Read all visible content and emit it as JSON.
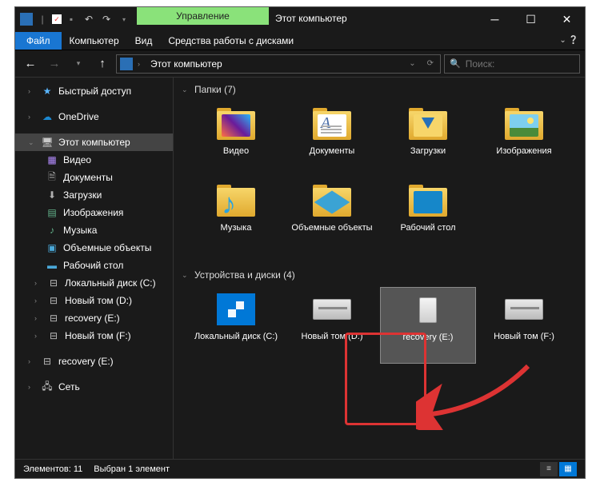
{
  "titlebar": {
    "manage_tab": "Управление",
    "window_title": "Этот компьютер"
  },
  "ribbon": {
    "file": "Файл",
    "computer": "Компьютер",
    "view": "Вид",
    "drive_tools": "Средства работы с дисками"
  },
  "address": {
    "path": "Этот компьютер"
  },
  "search": {
    "placeholder": "Поиск:"
  },
  "sidebar": {
    "quick_access": "Быстрый доступ",
    "onedrive": "OneDrive",
    "this_pc": "Этот компьютер",
    "video": "Видео",
    "documents": "Документы",
    "downloads": "Загрузки",
    "pictures": "Изображения",
    "music": "Музыка",
    "objects3d": "Объемные объекты",
    "desktop": "Рабочий стол",
    "local_c": "Локальный диск (C:)",
    "new_d": "Новый том (D:)",
    "recovery_e": "recovery (E:)",
    "new_f": "Новый том (F:)",
    "recovery_e2": "recovery (E:)",
    "network": "Сеть"
  },
  "sections": {
    "folders": "Папки (7)",
    "devices": "Устройства и диски (4)"
  },
  "folders": {
    "video": "Видео",
    "documents": "Документы",
    "downloads": "Загрузки",
    "pictures": "Изображения",
    "music": "Музыка",
    "objects3d": "Объемные объекты",
    "desktop": "Рабочий стол"
  },
  "drives": {
    "local_c": "Локальный диск (C:)",
    "new_d": "Новый том (D:)",
    "recovery_e": "recovery (E:)",
    "new_f": "Новый том (F:)"
  },
  "status": {
    "count": "Элементов: 11",
    "selected": "Выбран 1 элемент"
  }
}
